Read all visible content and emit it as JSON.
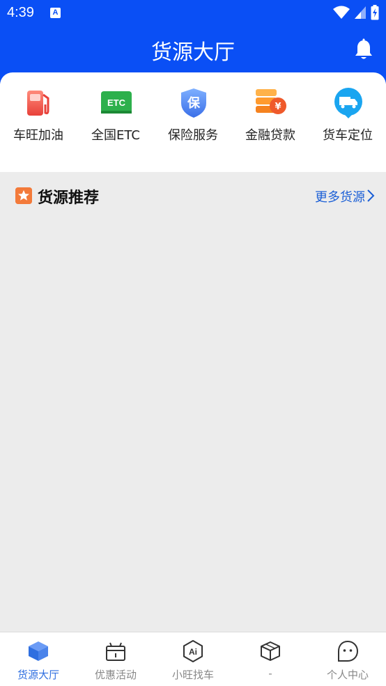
{
  "status": {
    "time": "4:39",
    "app_badge": "A"
  },
  "header": {
    "title": "货源大厅"
  },
  "services": [
    {
      "label": "车旺加油",
      "icon": "fuel-pump-icon"
    },
    {
      "label": "全国ETC",
      "icon": "etc-card-icon",
      "icon_text": "ETC"
    },
    {
      "label": "保险服务",
      "icon": "insurance-shield-icon",
      "icon_text": "保"
    },
    {
      "label": "金融贷款",
      "icon": "finance-coins-icon",
      "icon_text": "¥"
    },
    {
      "label": "货车定位",
      "icon": "truck-location-icon"
    }
  ],
  "section": {
    "title": "货源推荐",
    "more": "更多货源"
  },
  "tabs": [
    {
      "label": "货源大厅",
      "icon": "cube-icon",
      "active": true
    },
    {
      "label": "优惠活动",
      "icon": "gift-box-icon",
      "active": false
    },
    {
      "label": "小旺找车",
      "icon": "ai-badge-icon",
      "icon_text": "Ai",
      "active": false
    },
    {
      "label": "-",
      "icon": "package-icon",
      "active": false
    },
    {
      "label": "个人中心",
      "icon": "chat-face-icon",
      "active": false
    }
  ],
  "colors": {
    "brand_blue": "#0a4ff5",
    "accent_orange": "#f37a3a",
    "active_tab": "#2f6fe0"
  }
}
